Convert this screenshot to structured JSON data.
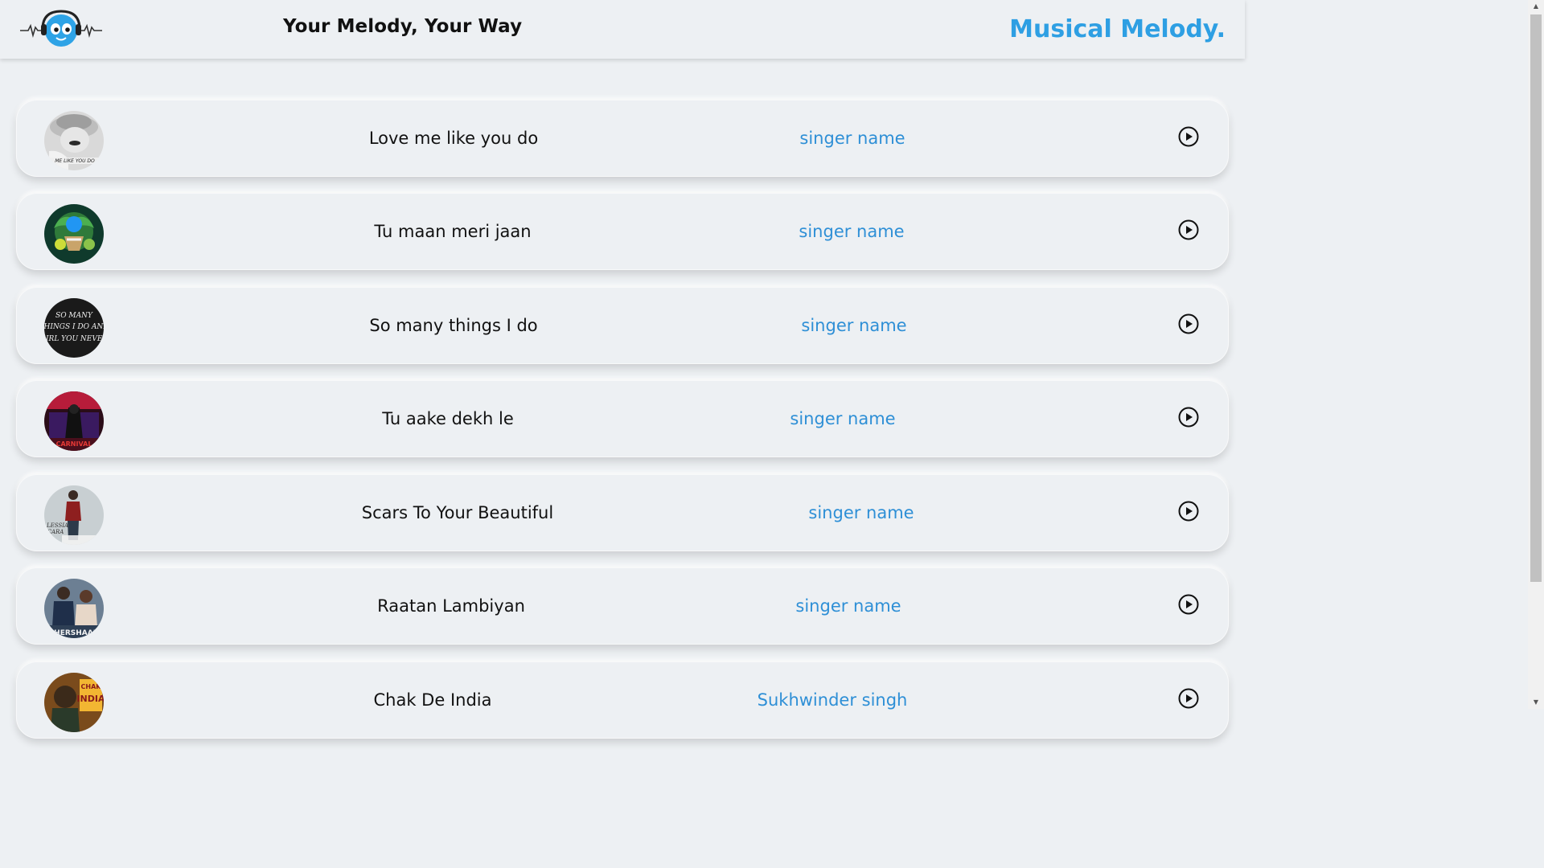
{
  "header": {
    "tagline": "Your Melody, Your Way",
    "brand": "Musical Melody.",
    "logo_icon": "headphone-smiley-logo"
  },
  "songs": [
    {
      "title": "Love me like you do",
      "singer": "singer name",
      "cover_icon": "album-cover"
    },
    {
      "title": "Tu maan meri jaan",
      "singer": "singer name",
      "cover_icon": "album-cover"
    },
    {
      "title": "So many things I do",
      "singer": "singer name",
      "cover_icon": "album-cover",
      "cover_text": "SO MANY THINGS I DO AND GIRL YOU NEVER"
    },
    {
      "title": "Tu aake dekh le",
      "singer": "singer name",
      "cover_icon": "album-cover",
      "cover_text": "CARNIVAL"
    },
    {
      "title": "Scars To Your Beautiful",
      "singer": "singer name",
      "cover_icon": "album-cover",
      "cover_text": "ALESSIA CARA"
    },
    {
      "title": "Raatan Lambiyan",
      "singer": "singer name",
      "cover_icon": "album-cover",
      "cover_text": "SHERSHAAH"
    },
    {
      "title": "Chak De India",
      "singer": "Sukhwinder singh",
      "cover_icon": "album-cover",
      "cover_text": "CHAK INDIA"
    }
  ],
  "colors": {
    "accent": "#2e9fe3",
    "singer_text": "#2e8fd6",
    "background": "#edf0f3"
  },
  "play_icon": "play-circle-icon"
}
